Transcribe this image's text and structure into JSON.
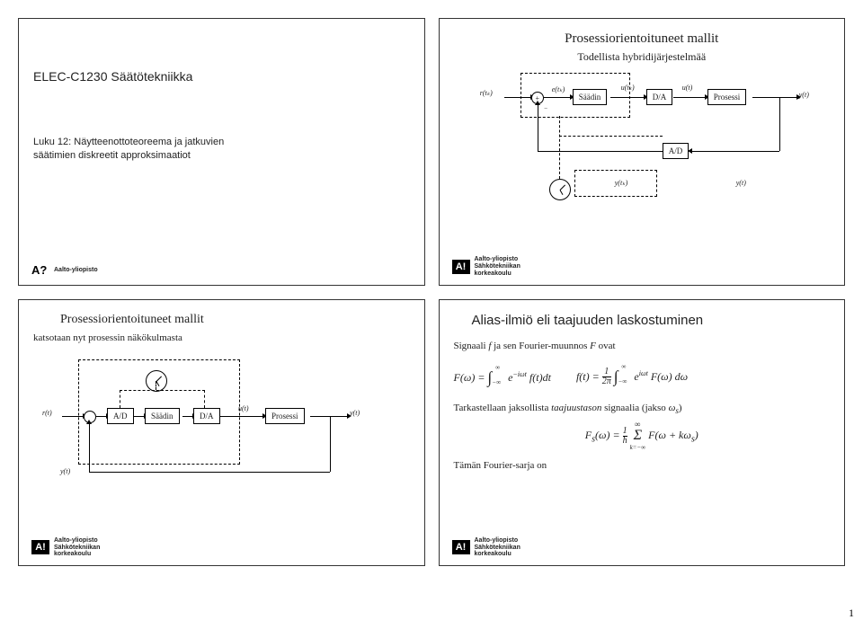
{
  "slide1": {
    "course": "ELEC-C1230 Säätötekniikka",
    "desc1": "Luku 12: Näytteenottoteoreema ja jatkuvien",
    "desc2": "säätimien diskreetit approksimaatiot",
    "logo_q": "A?",
    "logo_uni": "Aalto-yliopisto"
  },
  "slide2": {
    "title": "Prosessiorientoituneet mallit",
    "subtitle": "Todellista hybridijärjestelmää",
    "blocks": {
      "saadin": "Säädin",
      "da": "D/A",
      "prosessi": "Prosessi",
      "ad": "A/D"
    },
    "labels": {
      "r": "r(tₖ)",
      "e": "e(tₖ)",
      "utk": "u(tₖ)",
      "ut": "u(t)",
      "yt": "y(t)",
      "ytk": "y(tₖ)",
      "yt2": "y(t)"
    },
    "footer1": "Aalto-yliopisto",
    "footer2": "Sähkötekniikan",
    "footer3": "korkeakoulu",
    "logo": "A!"
  },
  "slide3": {
    "title": "Prosessiorientoituneet mallit",
    "sub": "katsotaan nyt prosessin näkökulmasta",
    "blocks": {
      "ad": "A/D",
      "saadin": "Säädin",
      "da": "D/A",
      "prosessi": "Prosessi"
    },
    "labels": {
      "r": "r(t)",
      "ut": "u(t)",
      "yt": "y(t)",
      "yt2": "y(t)"
    },
    "footer1": "Aalto-yliopisto",
    "footer2": "Sähkötekniikan",
    "footer3": "korkeakoulu",
    "logo": "A!"
  },
  "slide4": {
    "title": "Alias-ilmiö eli taajuuden laskostuminen",
    "line1_a": "Signaali ",
    "line1_b": "f",
    "line1_c": " ja sen Fourier-muunnos ",
    "line1_d": "F",
    "line1_e": " ovat",
    "eq1": "F(ω) = ∫₋∞^∞ e⁻ⁱωᵗ f(t) dt",
    "eq2": "f(t) = (1/2π) ∫₋∞^∞ eⁱωᵗ F(ω) dω",
    "line2": "Tarkastellaan jaksollista taajuustason signaalia (jakso ωₛ)",
    "eq3": "Fₛ(ω) = (1/h) Σₖ₌₋∞^∞ F(ω + kωₛ)",
    "line3": "Tämän Fourier-sarja on",
    "line2_emph": "taajuustason",
    "footer1": "Aalto-yliopisto",
    "footer2": "Sähkötekniikan",
    "footer3": "korkeakoulu",
    "logo": "A!"
  },
  "pagenum": "1"
}
